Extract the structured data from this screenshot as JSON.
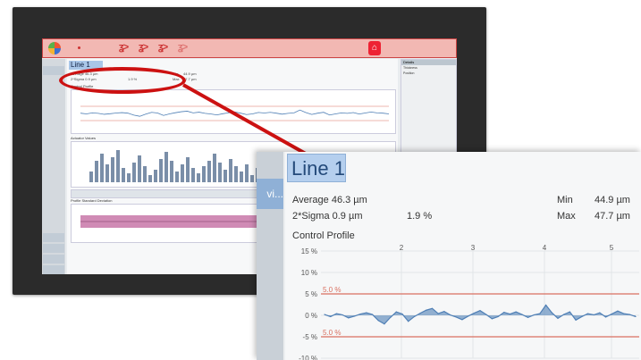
{
  "colors": {
    "accent": "#cc1111",
    "profile_line": "#4f7fb5",
    "limit_line": "#d97060",
    "tab_blue": "#b5cfee",
    "band": "#c877a8"
  },
  "titlebar": {
    "logo_icon": "app-logo-icon",
    "home_icon": "home-icon",
    "symbols": [
      "ʓ>",
      "ʓ>",
      "ʓ>",
      "ʓ>"
    ]
  },
  "screen": {
    "tab_label": "Line 1",
    "stats": {
      "average": "Average 46.3 µm",
      "sigma": "2*Sigma 0.9 µm",
      "sigma_pct": "1.9 %",
      "min_label": "Min",
      "min_value": "44.9 µm",
      "max_label": "Max",
      "max_value": "47.7 µm"
    },
    "panels": {
      "control_profile": "Control Profile",
      "actuator_values": "Actuator Values",
      "profile_std": "Profile Standard Deviation"
    },
    "props_header": "Details",
    "props": [
      "Thickness",
      "Position"
    ]
  },
  "zoom": {
    "tab_label": "Line 1",
    "nav_label": "vi...",
    "average": "Average 46.3 µm",
    "sigma": "2*Sigma 0.9 µm",
    "sigma_pct": "1.9 %",
    "min_label": "Min",
    "min_value": "44.9 µm",
    "max_label": "Max",
    "max_value": "47.7 µm",
    "chart_title": "Control Profile"
  },
  "chart_data": {
    "type": "line",
    "title": "Control Profile",
    "x_ticks": [
      "2",
      "3",
      "4",
      "5"
    ],
    "y_ticks": [
      "15 %",
      "10 %",
      "5 %",
      "0 %",
      "-5 %",
      "-10 %"
    ],
    "limit_labels": [
      "5.0 %",
      "5.0 %"
    ],
    "limits": [
      5,
      -5
    ],
    "ylim": [
      -10,
      15
    ],
    "series": [
      {
        "values": [
          0.2,
          -0.3,
          0.4,
          0.1,
          -0.6,
          -0.2,
          0.3,
          0.6,
          0.2,
          -1.2,
          -2.0,
          -0.5,
          0.8,
          0.3,
          -1.4,
          -0.3,
          0.5,
          1.2,
          1.6,
          0.4,
          0.9,
          0.1,
          -0.4,
          -1.0,
          -0.2,
          0.5,
          1.1,
          0.2,
          -0.8,
          -0.3,
          0.7,
          0.3,
          0.8,
          0.2,
          -0.5,
          0.1,
          0.4,
          2.4,
          0.6,
          -0.7,
          0.2,
          0.8,
          -1.1,
          -0.3,
          0.4,
          0.1,
          0.6,
          -0.4,
          0.3,
          1.0,
          0.4,
          0.2,
          -0.3
        ]
      }
    ]
  }
}
